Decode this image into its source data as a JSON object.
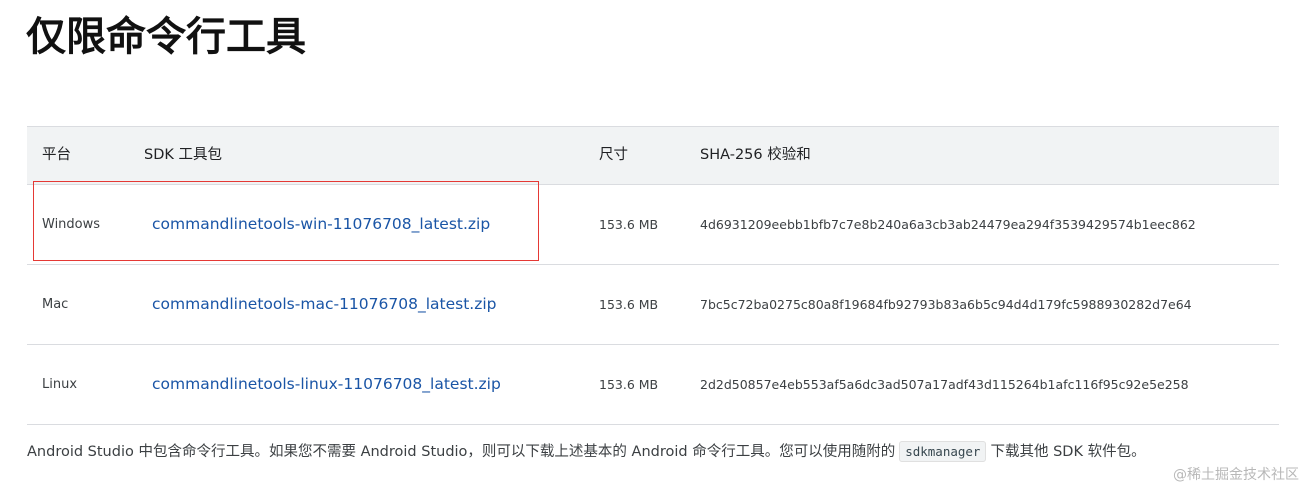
{
  "page": {
    "title": "仅限命令行工具"
  },
  "table": {
    "headers": {
      "platform": "平台",
      "package": "SDK 工具包",
      "size": "尺寸",
      "checksum": "SHA-256 校验和"
    },
    "rows": [
      {
        "platform": "Windows",
        "package": "commandlinetools-win-11076708_latest.zip",
        "size": "153.6 MB",
        "checksum": "4d6931209eebb1bfb7c7e8b240a6a3cb3ab24479ea294f3539429574b1eec862"
      },
      {
        "platform": "Mac",
        "package": "commandlinetools-mac-11076708_latest.zip",
        "size": "153.6 MB",
        "checksum": "7bc5c72ba0275c80a8f19684fb92793b83a6b5c94d4d179fc5988930282d7e64"
      },
      {
        "platform": "Linux",
        "package": "commandlinetools-linux-11076708_latest.zip",
        "size": "153.6 MB",
        "checksum": "2d2d50857e4eb553af5a6dc3ad507a17adf43d115264b1afc116f95c92e5e258"
      }
    ]
  },
  "footnote": {
    "text_before": "Android Studio 中包含命令行工具。如果您不需要 Android Studio，则可以下载上述基本的 Android 命令行工具。您可以使用随附的",
    "code": "sdkmanager",
    "text_after": "下载其他 SDK 软件包。"
  },
  "watermark": "@稀土掘金技术社区",
  "colors": {
    "link": "#1a55a6",
    "highlight_border": "#e53935",
    "header_bg": "#f1f3f4"
  }
}
